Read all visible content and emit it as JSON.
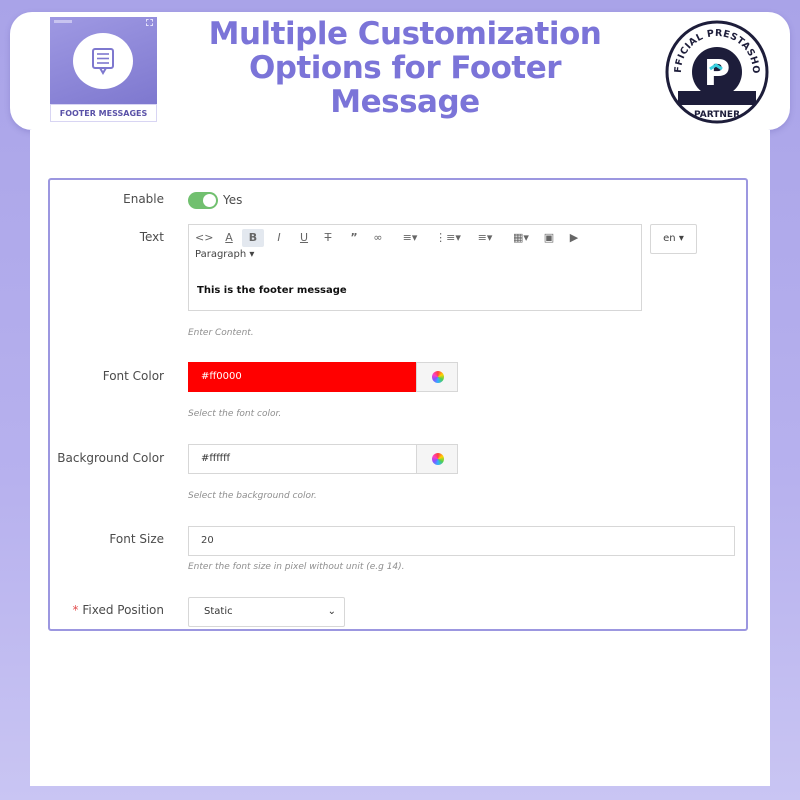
{
  "banner": {
    "product_label": "FOOTER MESSAGES",
    "headline": [
      "Multiple Customization",
      "Options for Footer",
      "Message"
    ],
    "badge_top": "OFFICIAL PRESTASHOP",
    "badge_bottom": "PARTNER"
  },
  "form": {
    "enable": {
      "label": "Enable",
      "value": "Yes",
      "on": true
    },
    "text": {
      "label": "Text",
      "toolbar": [
        "code",
        "font-color",
        "bold",
        "italic",
        "underline",
        "strikethrough",
        "quote",
        "link",
        "align",
        "bullet-list",
        "numbered-list",
        "table",
        "image",
        "media"
      ],
      "paragraph_label": "Paragraph",
      "content": "This is the footer message",
      "help": "Enter Content.",
      "language": "en"
    },
    "font_color": {
      "label": "Font Color",
      "value": "#ff0000",
      "help": "Select the font color.",
      "swatch": "#ff0000"
    },
    "background_color": {
      "label": "Background Color",
      "value": "#ffffff",
      "help": "Select the background color.",
      "swatch": "#ffffff"
    },
    "font_size": {
      "label": "Font Size",
      "value": "20",
      "help": "Enter the font size in pixel without unit (e.g 14)."
    },
    "fixed_position": {
      "label": "Fixed Position",
      "required_mark": "*",
      "value": "Static"
    }
  },
  "colors": {
    "accent": "#7b74d8",
    "toggle_on": "#71c06f",
    "panel_border": "#9c97e0"
  }
}
